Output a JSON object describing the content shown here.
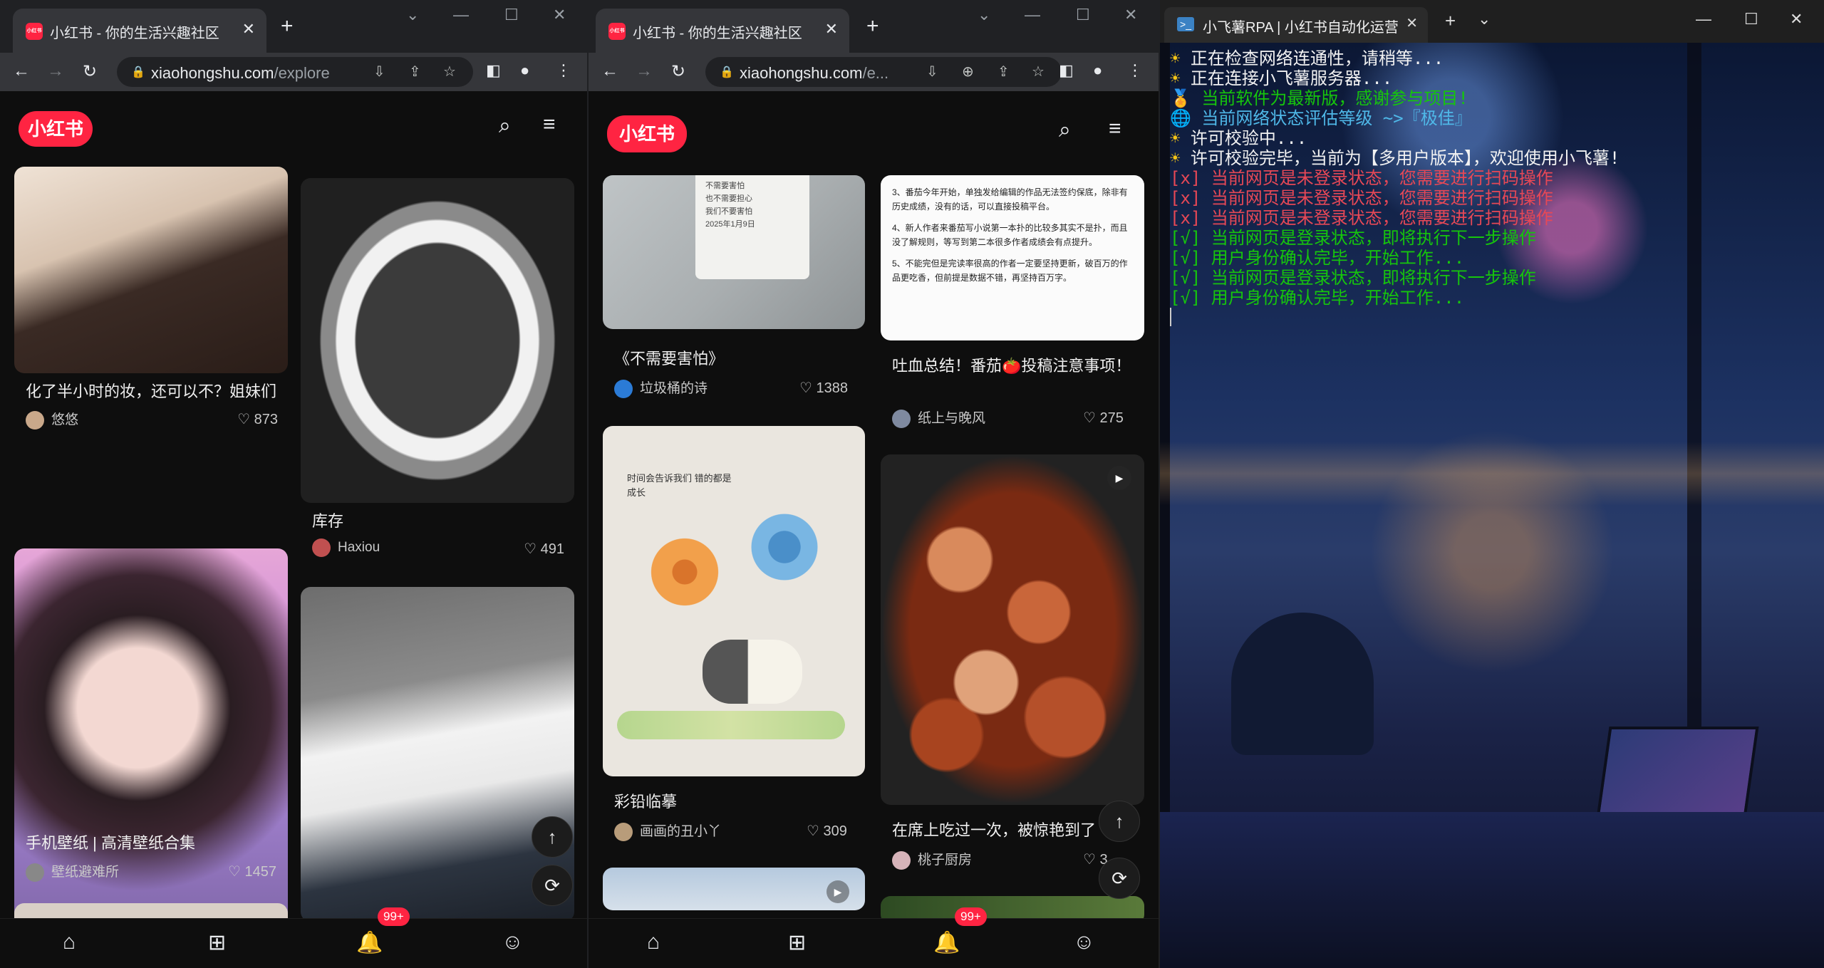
{
  "browser": {
    "tab_title": "小红书 - 你的生活兴趣社区",
    "favicon_text": "小红书",
    "new_tab": "+",
    "close": "✕",
    "url_host": "xiaohongshu.com",
    "url_path_full": "/explore",
    "url_path_short": "/e..."
  },
  "site": {
    "logo": "小红书"
  },
  "feed1": {
    "left": [
      {
        "title": "化了半小时的妆，还可以不？姐妹们",
        "author": "悠悠",
        "likes": "873"
      },
      {
        "title": "手机壁纸 | 高清壁纸合集",
        "author": "壁纸避难所",
        "likes": "1457"
      }
    ],
    "right": [
      {
        "title": "库存",
        "author": "Haxiou",
        "likes": "491"
      }
    ]
  },
  "feed2": {
    "left": [
      {
        "title": "《不需要害怕》",
        "author": "垃圾桶的诗",
        "likes": "1388",
        "note_lines": [
          "不需要害怕",
          "也不需要担心",
          "我们不要害怕",
          "2025年1月9日"
        ]
      },
      {
        "title": "彩铅临摹",
        "author": "画画的丑小丫",
        "likes": "309",
        "drawing_text": "时间会告诉我们 错的都是成长",
        "drawing_text_line2": "成长"
      }
    ],
    "right": [
      {
        "title": "吐血总结！番茄🍅投稿注意事项！",
        "author": "纸上与晚风",
        "likes": "275",
        "doc_lines": [
          "3、番茄今年开始，单独发给编辑的作品无法签约保底，除非有历史成绩，没有的话，可以直接投稿平台。",
          "4、新人作者来番茄写小说第一本扑的比较多其实不是扑，而且没了解规则，等写到第二本很多作者成绩会有点提升。",
          "5、不能完但是完读率很高的作者一定要坚持更新，破百万的作品更吃香，但前提是数据不错，再坚持百万字。"
        ]
      },
      {
        "title": "在席上吃过一次，被惊艳到了",
        "author": "桃子厨房",
        "likes": "3"
      }
    ]
  },
  "bottom_nav": {
    "badge": "99+"
  },
  "terminal": {
    "tab_title": "小飞薯RPA | 小红书自动化运营",
    "lines": [
      {
        "icon": "☀",
        "text": "正在检查网络连通性，请稍等...",
        "color": "#f2f2f2"
      },
      {
        "icon": "☀",
        "text": "正在连接小飞薯服务器...",
        "color": "#f2f2f2"
      },
      {
        "icon": "🏅",
        "text": "当前软件为最新版，感谢参与项目!",
        "color": "#16c60c"
      },
      {
        "icon": "🌐",
        "text": "当前网络状态评估等级 ~>『极佳』",
        "color": "#4fb8e8"
      },
      {
        "icon": "☀",
        "text": "许可校验中...",
        "color": "#f2f2f2"
      },
      {
        "icon": "☀",
        "text": "许可校验完毕，当前为【多用户版本】，欢迎使用小飞薯!",
        "color": "#f2f2f2"
      },
      {
        "icon": "",
        "text": "[x] 当前网页是未登录状态，您需要进行扫码操作",
        "color": "#e74856"
      },
      {
        "icon": "",
        "text": "[x] 当前网页是未登录状态，您需要进行扫码操作",
        "color": "#e74856"
      },
      {
        "icon": "",
        "text": "[x] 当前网页是未登录状态，您需要进行扫码操作",
        "color": "#e74856"
      },
      {
        "icon": "",
        "text": "[√] 当前网页是登录状态，即将执行下一步操作",
        "color": "#16c60c"
      },
      {
        "icon": "",
        "text": "[√] 用户身份确认完毕，开始工作...",
        "color": "#16c60c"
      },
      {
        "icon": "",
        "text": "[√] 当前网页是登录状态，即将执行下一步操作",
        "color": "#16c60c"
      },
      {
        "icon": "",
        "text": "[√] 用户身份确认完毕，开始工作...",
        "color": "#16c60c"
      }
    ]
  }
}
